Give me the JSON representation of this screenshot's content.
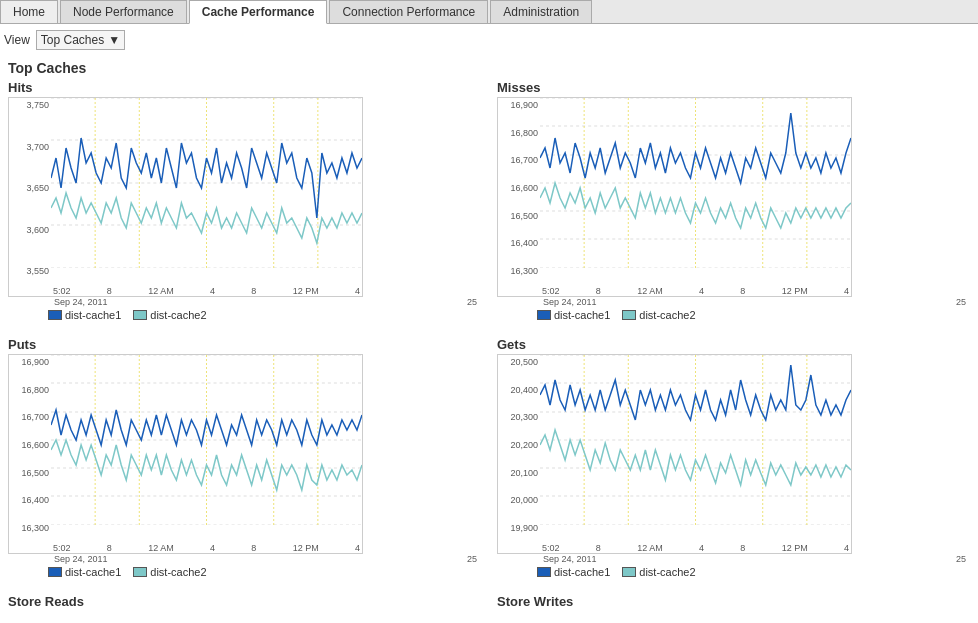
{
  "tabs": [
    {
      "id": "home",
      "label": "Home",
      "active": false
    },
    {
      "id": "node-performance",
      "label": "Node Performance",
      "active": false
    },
    {
      "id": "cache-performance",
      "label": "Cache Performance",
      "active": true
    },
    {
      "id": "connection-performance",
      "label": "Connection Performance",
      "active": false
    },
    {
      "id": "administration",
      "label": "Administration",
      "active": false
    }
  ],
  "view": {
    "label": "View",
    "select_label": "Top Caches",
    "chevron": "▼"
  },
  "section": {
    "title": "Top Caches"
  },
  "charts": [
    {
      "id": "hits",
      "title": "Hits",
      "y_labels": [
        "3,750",
        "3,700",
        "3,650",
        "3,600",
        "3,550"
      ],
      "x_labels": [
        "5:02",
        "8",
        "12 AM",
        "4",
        "8",
        "12 PM",
        "4"
      ],
      "date_labels": [
        "Sep 24, 2011",
        "25"
      ],
      "legend": [
        {
          "id": "dist-cache1",
          "label": "dist-cache1",
          "color": "swatch-blue"
        },
        {
          "id": "dist-cache2",
          "label": "dist-cache2",
          "color": "swatch-teal"
        }
      ]
    },
    {
      "id": "misses",
      "title": "Misses",
      "y_labels": [
        "16,900",
        "16,800",
        "16,700",
        "16,600",
        "16,500",
        "16,400",
        "16,300"
      ],
      "x_labels": [
        "5:02",
        "8",
        "12 AM",
        "4",
        "8",
        "12 PM",
        "4"
      ],
      "date_labels": [
        "Sep 24, 2011",
        "25"
      ],
      "legend": [
        {
          "id": "dist-cache1",
          "label": "dist-cache1",
          "color": "swatch-blue"
        },
        {
          "id": "dist-cache2",
          "label": "dist-cache2",
          "color": "swatch-teal"
        }
      ]
    },
    {
      "id": "puts",
      "title": "Puts",
      "y_labels": [
        "16,900",
        "16,800",
        "16,700",
        "16,600",
        "16,500",
        "16,400",
        "16,300"
      ],
      "x_labels": [
        "5:02",
        "8",
        "12 AM",
        "4",
        "8",
        "12 PM",
        "4"
      ],
      "date_labels": [
        "Sep 24, 2011",
        "25"
      ],
      "legend": [
        {
          "id": "dist-cache1",
          "label": "dist-cache1",
          "color": "swatch-blue"
        },
        {
          "id": "dist-cache2",
          "label": "dist-cache2",
          "color": "swatch-teal"
        }
      ]
    },
    {
      "id": "gets",
      "title": "Gets",
      "y_labels": [
        "20,500",
        "20,400",
        "20,300",
        "20,200",
        "20,100",
        "20,000",
        "19,900"
      ],
      "x_labels": [
        "5:02",
        "8",
        "12 AM",
        "4",
        "8",
        "12 PM",
        "4"
      ],
      "date_labels": [
        "Sep 24, 2011",
        "25"
      ],
      "legend": [
        {
          "id": "dist-cache1",
          "label": "dist-cache1",
          "color": "swatch-blue"
        },
        {
          "id": "dist-cache2",
          "label": "dist-cache2",
          "color": "swatch-teal"
        }
      ]
    }
  ],
  "bottom_titles": [
    "Store Reads",
    "Store Writes"
  ]
}
